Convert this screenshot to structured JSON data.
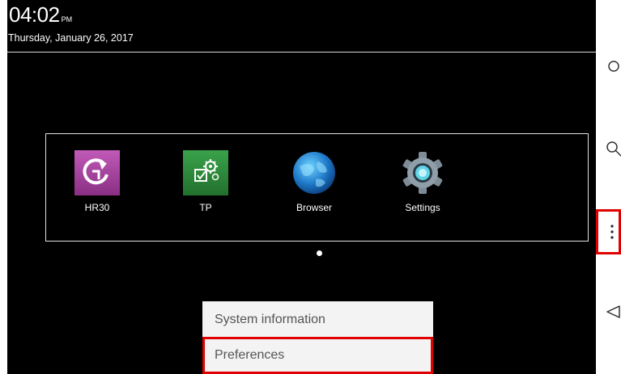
{
  "status": {
    "time": "04:02",
    "ampm": "PM",
    "date": "Thursday, January 26, 2017"
  },
  "apps": [
    {
      "label": "HR30",
      "icon": "hr30-refresh-icon"
    },
    {
      "label": "TP",
      "icon": "tp-settings-check-icon"
    },
    {
      "label": "Browser",
      "icon": "globe-icon"
    },
    {
      "label": "Settings",
      "icon": "gear-icon"
    }
  ],
  "pager": {
    "current_page": 1,
    "total_pages": 1
  },
  "menu": {
    "items": [
      {
        "label": "System information"
      },
      {
        "label": "Preferences"
      }
    ]
  },
  "navbar": {
    "buttons": [
      "home-circle-icon",
      "search-icon",
      "overflow-menu-icon",
      "back-triangle-icon"
    ]
  },
  "colors": {
    "background": "#000000",
    "highlight": "#e00000",
    "menu_bg": "#f3f3f3",
    "hr30_tile": "#a03a9a",
    "tp_tile": "#2e8b3c"
  }
}
